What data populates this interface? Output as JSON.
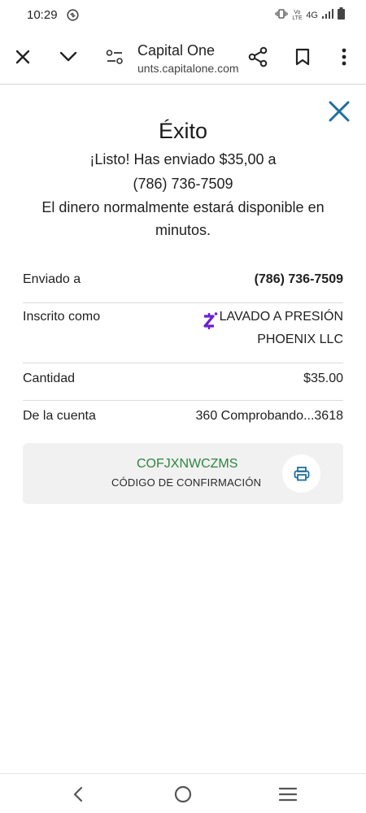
{
  "status_bar": {
    "time": "10:29",
    "volte": "Vo LTE",
    "network": "4G"
  },
  "browser": {
    "title": "Capital One",
    "url": "unts.capitalone.com"
  },
  "confirmation": {
    "heading": "Éxito",
    "message_lines": [
      "¡Listo! Has enviado $35,00 a",
      "(786) 736-7509",
      "El dinero normalmente estará disponible en",
      "minutos."
    ],
    "details": {
      "sent_to": {
        "label": "Enviado a",
        "value": "(786) 736-7509"
      },
      "enrolled_as": {
        "label": "Inscrito como",
        "value_line1": "LAVADO A PRESIÓN",
        "value_line2": "PHOENIX LLC",
        "icon": "zelle-icon"
      },
      "amount": {
        "label": "Cantidad",
        "value": "$35.00"
      },
      "from_account": {
        "label": "De la cuenta",
        "value": "360 Comprobando...3618"
      }
    },
    "code_card": {
      "code": "COFJXNWCZMS",
      "label": "CÓDIGO DE CONFIRMACIÓN",
      "print_icon": "printer-icon"
    }
  },
  "colors": {
    "accent_blue": "#1f6f9f",
    "code_green": "#2e8540",
    "zelle_purple": "#6d1ed4"
  }
}
